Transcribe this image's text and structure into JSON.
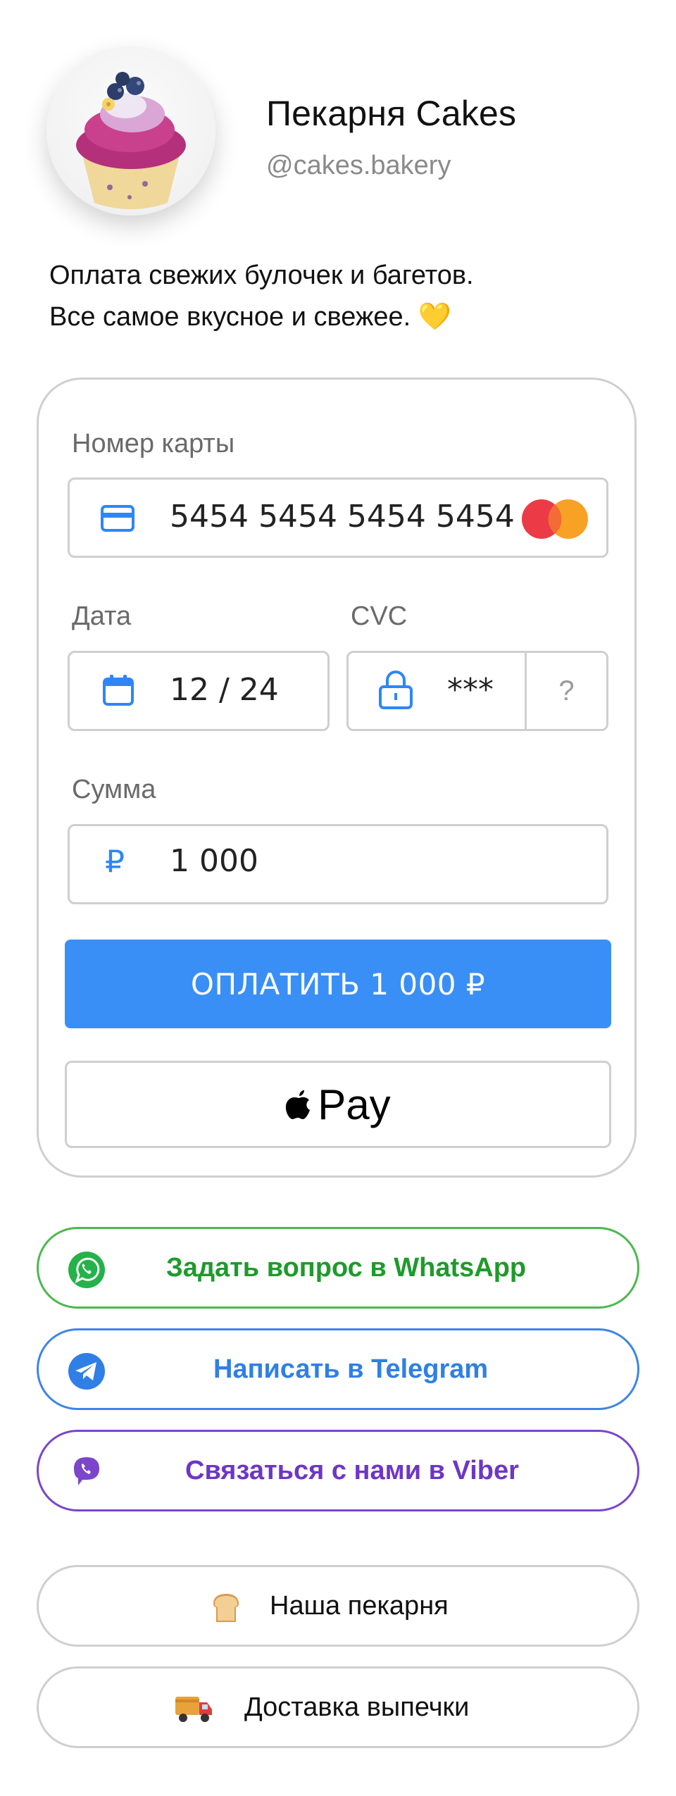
{
  "profile": {
    "name": "Пекарня Cakes",
    "handle": "@cakes.bakery",
    "description_line1": "Оплата свежих булочек и багетов.",
    "description_line2": "Все самое вкусное и свежее.",
    "description_emoji": "💛"
  },
  "payment": {
    "card_label": "Номер карты",
    "card_number": "5454 5454 5454 5454",
    "date_label": "Дата",
    "date_value": "12 / 24",
    "cvc_label": "CVC",
    "cvc_value": "***",
    "cvc_help": "?",
    "amount_label": "Сумма",
    "currency_symbol": "₽",
    "amount_value": "1 000",
    "pay_button": "ОПЛАТИТЬ 1 000 ₽",
    "apple_pay_label": "Pay",
    "accent_color": "#3a8ff6"
  },
  "contacts": {
    "whatsapp": {
      "label": "Задать вопрос в WhatsApp",
      "color": "#1f9a2c",
      "icon": "whatsapp-icon"
    },
    "telegram": {
      "label": "Написать в Telegram",
      "color": "#2f7fe6",
      "icon": "telegram-icon"
    },
    "viber": {
      "label": "Связаться с нами в Viber",
      "color": "#6e36c6",
      "icon": "viber-icon"
    }
  },
  "links": {
    "bakery": {
      "label": "Наша пекарня",
      "icon": "bread-icon"
    },
    "delivery": {
      "label": "Доставка выпечки",
      "icon": "delivery-truck-icon"
    }
  }
}
